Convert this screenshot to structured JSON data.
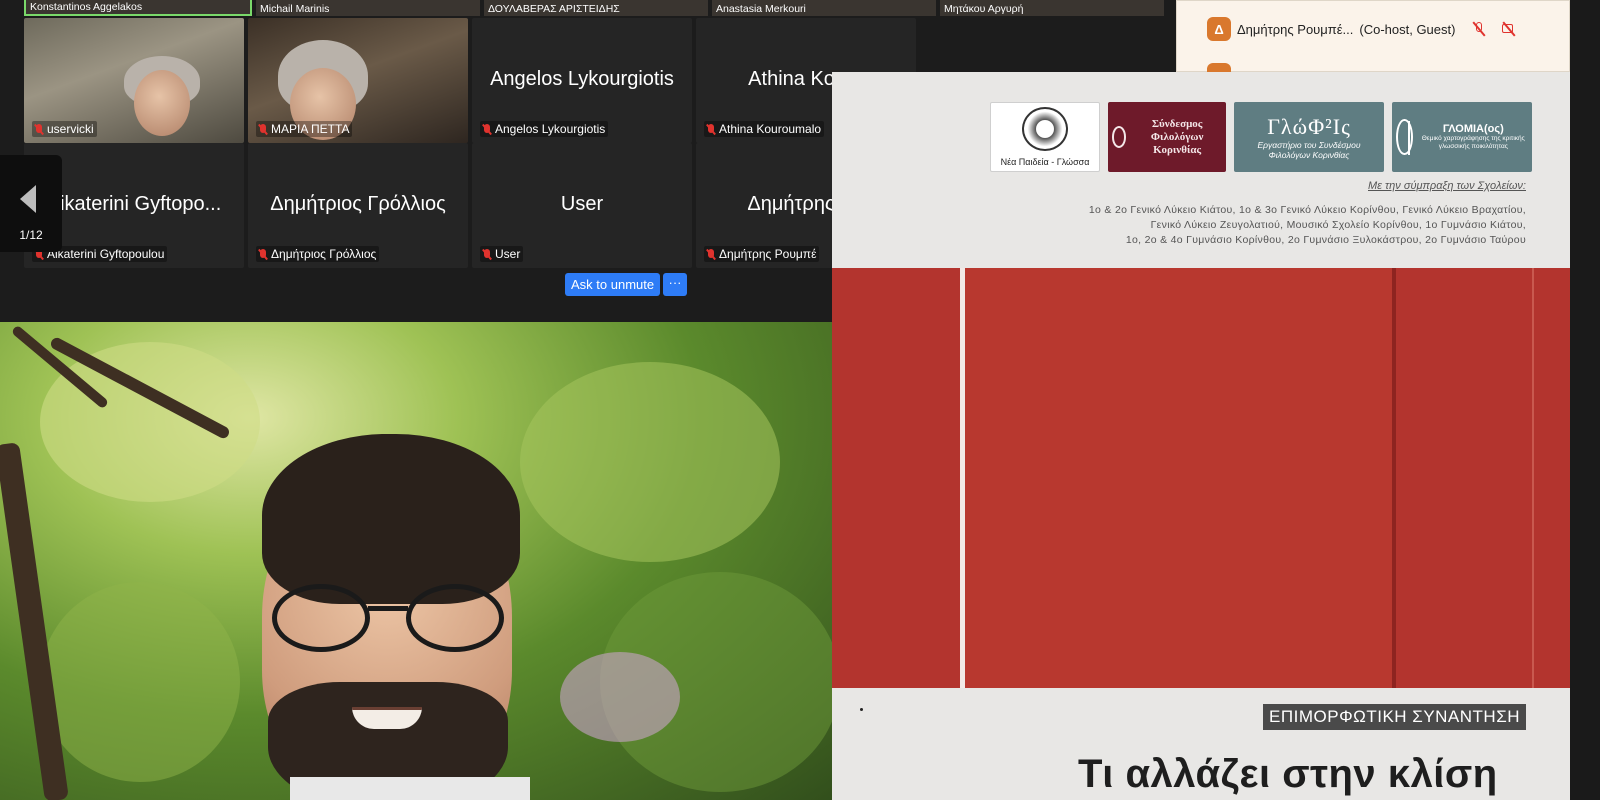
{
  "top_strip": [
    {
      "name": "Konstantinos Aggelakos",
      "active": true
    },
    {
      "name": "Michail Marinis",
      "active": false
    },
    {
      "name": "ΔΟΥΛΑΒΕΡΑΣ ΑΡΙΣΤΕΙΔΗΣ",
      "active": false
    },
    {
      "name": "Anastasia Merkouri",
      "active": false
    },
    {
      "name": "Μητάκου Αργυρή",
      "active": false
    }
  ],
  "tiles": [
    {
      "big": "",
      "small": "uservicki",
      "video": "a"
    },
    {
      "big": "",
      "small": "ΜΑΡΙΑ ΠΕΤΤΑ",
      "video": "b"
    },
    {
      "big": "Angelos Lykourgiotis",
      "small": "Angelos Lykourgiotis"
    },
    {
      "big": "Athina Kouro",
      "small": "Athina Kouroumalo"
    },
    {
      "big": "Aikaterini Gyftopo...",
      "small": "Aikaterini Gyftopoulou"
    },
    {
      "big": "Δημήτριος Γρόλλιος",
      "small": "Δημήτριος Γρόλλιος"
    },
    {
      "big": "User",
      "small": "User"
    },
    {
      "big": "Δημήτρης Ρο",
      "small": "Δημήτρης Ρουμπέ"
    }
  ],
  "pager": {
    "label": "1/12"
  },
  "controls": {
    "ask_unmute": "Ask to unmute",
    "more": "···"
  },
  "participants": {
    "avatar_letter": "Δ",
    "name": "Δημήτρης Ρουμπέ...",
    "role": "(Co-host, Guest)"
  },
  "poster": {
    "logo1": "Νέα Παιδεία - Γλώσσα",
    "logo2": "Σύνδεσμος Φιλολόγων Κορινθίας",
    "logo3_title": "ΓλώΦ²Ις",
    "logo3_sub": "Εργαστήριο του Συνδέσμου Φιλολόγων Κορινθίας",
    "logo4_title": "ΓΛΟΜΙΑ(ος)",
    "logo4_sub": "Θεμικό χαρτογράφησης της κριτικής γλωσσικής ποικιλότητας",
    "cooperation": "Με την σύμπραξη των Σχολείων:",
    "schools_1": "1ο & 2ο Γενικό Λύκειο Κιάτου, 1ο & 3ο Γενικό Λύκειο Κορίνθου, Γενικό Λύκειο Βραχατίου,",
    "schools_2": "Γενικό Λύκειο Ζευγολατιού, Μουσικό Σχολείο Κορίνθου, 1ο Γυμνάσιο Κιάτου,",
    "schools_3": "1ο, 2ο & 4ο Γυμνάσιο Κορίνθου, 2ο Γυμνάσιο Ξυλοκάστρου, 2ο Γυμνάσιο Ταύρου",
    "event_type": "ΕΠΙΜΟΡΦΩΤΙΚΗ ΣΥΝΑΝΤΗΣΗ",
    "title": "Τι αλλάζει στην κλίση"
  }
}
